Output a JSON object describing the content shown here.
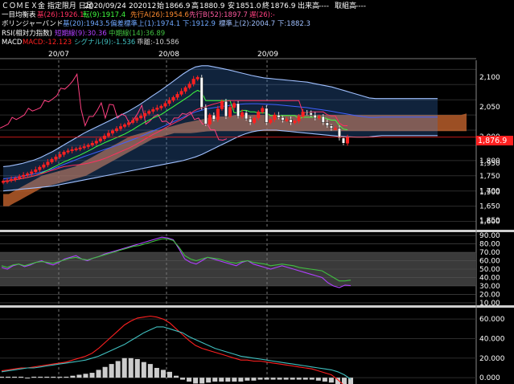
{
  "header": {
    "symbol": "ＣＯＭＥＸ金 指定限月 日足",
    "date": "2020/09/24",
    "contract": "202012",
    "open_label": "始",
    "open": "1866.9",
    "high_label": "高",
    "high": "1880.9",
    "low_label": "安",
    "low": "1851.0",
    "close_label": "終",
    "close": "1876.9",
    "volume_label": "出来高",
    "volume": "----",
    "oi_label": "取組高",
    "oi": "----"
  },
  "indicators": {
    "ichimoku": {
      "name": "一目均衡表",
      "base": "基(26):1926.1",
      "conv": "転(9):1917.4",
      "span_a": "先行A(26):1954.6",
      "span_b": "先行B(52):1897.7",
      "lag": "遅(26):-"
    },
    "bollinger": {
      "name": "ボリンジャーバンド",
      "mid": "基(20):1943.5",
      "band1": "偏差標準上(1):1974.1 下:1912.9",
      "band2": "標準上(2):2004.7 下:1882.3"
    },
    "rsi": {
      "name": "RSI(相対力指数)",
      "short": "短期線(9):30.36",
      "long": "中期線(14):36.89"
    },
    "macd": {
      "name": "MACD",
      "macd": "MACD:-12.123",
      "signal": "シグナル(9):-1.536",
      "hist": "乖離:-10.586"
    }
  },
  "colors": {
    "background": "#000000",
    "label": "#ffffff",
    "up_candle": "#ff2020",
    "down_candle": "#ffffff",
    "ichimoku_cloud": "#d06a30",
    "bollinger_fill": "#3a7fd6",
    "base_line": "#ff3060",
    "conv_line": "#40ff40",
    "span_a": "#ff8c30",
    "span_b": "#ff5aa0",
    "lag_line": "#ff4080",
    "bb_mid": "#4060ff",
    "bb_1": "#6fa8ff",
    "bb_2": "#a0c0ff",
    "rsi_short": "#b040ff",
    "rsi_long": "#40c040",
    "macd": "#ff2020",
    "signal": "#40c0c0",
    "hist": "#cccccc",
    "last_price_box": "#ff2020",
    "divider": "#cfcfcf"
  },
  "chart_data": [
    {
      "type": "candlestick",
      "panel": "price",
      "x_labels": [
        "20/07",
        "20/08",
        "20/09"
      ],
      "ylim": [
        1575,
        2130
      ],
      "y_ticks": [
        "1,600",
        "1,650",
        "1,700",
        "1,750",
        "1,800",
        "1,850",
        "1,900",
        "1,950",
        "2,000",
        "2,050",
        "2,100"
      ],
      "y_tick_values": [
        1600,
        1650,
        1700,
        1750,
        1800,
        1850,
        1900,
        1950,
        2000,
        2050,
        2100
      ],
      "last_price_label": "1,876.9",
      "last_price": 1876.9,
      "close_series": [
        1732,
        1734,
        1738,
        1742,
        1747,
        1752,
        1757,
        1763,
        1770,
        1778,
        1786,
        1795,
        1804,
        1812,
        1820,
        1828,
        1832,
        1836,
        1839,
        1842,
        1846,
        1851,
        1857,
        1864,
        1872,
        1881,
        1890,
        1898,
        1905,
        1912,
        1918,
        1925,
        1932,
        1940,
        1947,
        1955,
        1962,
        1968,
        1973,
        1979,
        1988,
        1998,
        2008,
        2018,
        2028,
        2040,
        2052,
        2068,
        2074,
        1975,
        1920,
        1950,
        1935,
        1970,
        1995,
        1945,
        1975,
        1988,
        1945,
        1958,
        1937,
        1925,
        1940,
        1960,
        1972,
        1925,
        1935,
        1950,
        1942,
        1933,
        1935,
        1925,
        1930,
        1945,
        1960,
        1957,
        1950,
        1940,
        1945,
        1925,
        1914,
        1906,
        1906,
        1874,
        1857,
        1876.9
      ],
      "bb_upper_series": [
        1780,
        1782,
        1786,
        1790,
        1796,
        1802,
        1810,
        1820,
        1830,
        1842,
        1854,
        1866,
        1878,
        1890,
        1900,
        1910,
        1920,
        1930,
        1940,
        1950,
        1960,
        1972,
        1984,
        1998,
        2012,
        2026,
        2040,
        2055,
        2070,
        2085,
        2098,
        2108,
        2112,
        2112,
        2108,
        2104,
        2100,
        2095,
        2090,
        2085,
        2080,
        2076,
        2072,
        2070,
        2068,
        2066,
        2064,
        2062,
        2060,
        2058,
        2054,
        2050,
        2046,
        2042,
        2036,
        2030,
        2024,
        2018,
        2012,
        2006,
        2004,
        2004,
        2004,
        2004,
        2004,
        2004,
        2004,
        2004,
        2004,
        2004,
        2004
      ],
      "bb_lower_series": [
        1700,
        1702,
        1704,
        1706,
        1708,
        1710,
        1712,
        1714,
        1716,
        1720,
        1724,
        1728,
        1732,
        1736,
        1740,
        1744,
        1748,
        1752,
        1756,
        1760,
        1764,
        1768,
        1772,
        1776,
        1780,
        1784,
        1788,
        1792,
        1796,
        1800,
        1806,
        1812,
        1820,
        1830,
        1840,
        1850,
        1860,
        1870,
        1880,
        1888,
        1894,
        1898,
        1900,
        1900,
        1900,
        1898,
        1896,
        1894,
        1892,
        1890,
        1888,
        1886,
        1884,
        1882,
        1880,
        1879,
        1878,
        1877,
        1877,
        1878,
        1880,
        1882,
        1882,
        1882,
        1882,
        1882,
        1882,
        1882,
        1882,
        1882,
        1882
      ],
      "cloud_top_series": [
        1690,
        1690,
        1700,
        1710,
        1720,
        1730,
        1740,
        1750,
        1755,
        1760,
        1765,
        1770,
        1775,
        1780,
        1790,
        1800,
        1810,
        1820,
        1830,
        1840,
        1850,
        1860,
        1870,
        1880,
        1885,
        1890,
        1895,
        1900,
        1900,
        1905,
        1910,
        1915,
        1920,
        1925,
        1928,
        1932,
        1935,
        1940,
        1942,
        1945,
        1945,
        1945,
        1950,
        1950,
        1950,
        1950,
        1950,
        1950,
        1950,
        1950,
        1950,
        1950,
        1950,
        1950,
        1950,
        1950,
        1950,
        1950,
        1950,
        1950,
        1950,
        1950,
        1950,
        1950,
        1950,
        1950,
        1950,
        1950,
        1950,
        1950,
        1950,
        1950,
        1950,
        1950,
        1950,
        1950,
        1950,
        1950,
        1950,
        1950,
        1950,
        1950,
        1950,
        1950,
        1955
      ],
      "cloud_bot_series": [
        1650,
        1650,
        1660,
        1670,
        1680,
        1690,
        1700,
        1710,
        1715,
        1720,
        1725,
        1730,
        1735,
        1740,
        1745,
        1750,
        1760,
        1770,
        1780,
        1790,
        1800,
        1810,
        1820,
        1830,
        1840,
        1850,
        1860,
        1870,
        1875,
        1880,
        1885,
        1890,
        1890,
        1890,
        1890,
        1892,
        1894,
        1896,
        1897,
        1897,
        1897,
        1897,
        1897,
        1897,
        1897,
        1897,
        1897,
        1897,
        1897,
        1897,
        1897,
        1897,
        1897,
        1897,
        1897,
        1897,
        1897,
        1897,
        1897,
        1897,
        1897,
        1897,
        1897,
        1897,
        1897,
        1897,
        1897,
        1897,
        1897,
        1897,
        1897,
        1897,
        1897,
        1897,
        1897,
        1897,
        1897,
        1897,
        1897,
        1897,
        1897,
        1897,
        1897,
        1897,
        1897
      ]
    },
    {
      "type": "line",
      "panel": "rsi",
      "ylim": [
        8,
        92
      ],
      "y_ticks": [
        "10.00",
        "20.00",
        "30.00",
        "40.00",
        "50.00",
        "60.00",
        "70.00",
        "80.00",
        "90.00"
      ],
      "y_tick_values": [
        10,
        20,
        30,
        40,
        50,
        60,
        70,
        80,
        90
      ],
      "series": [
        {
          "name": "短期線(9)",
          "values": [
            52,
            50,
            54,
            56,
            53,
            55,
            58,
            60,
            57,
            55,
            58,
            62,
            64,
            66,
            62,
            60,
            63,
            65,
            68,
            70,
            72,
            74,
            76,
            78,
            80,
            82,
            84,
            86,
            88,
            87,
            85,
            74,
            62,
            58,
            56,
            60,
            64,
            62,
            60,
            58,
            56,
            54,
            58,
            60,
            56,
            54,
            52,
            50,
            52,
            54,
            52,
            50,
            48,
            46,
            44,
            42,
            40,
            34,
            30,
            28,
            31,
            30.36
          ]
        },
        {
          "name": "中期線(14)",
          "values": [
            54,
            52,
            55,
            56,
            54,
            56,
            58,
            59,
            58,
            57,
            59,
            61,
            63,
            64,
            62,
            61,
            63,
            65,
            67,
            69,
            71,
            73,
            75,
            77,
            78,
            80,
            82,
            84,
            86,
            86,
            84,
            76,
            66,
            62,
            60,
            62,
            64,
            63,
            62,
            60,
            58,
            57,
            59,
            60,
            58,
            57,
            56,
            54,
            55,
            56,
            55,
            54,
            52,
            51,
            50,
            49,
            48,
            44,
            40,
            36,
            36,
            36.89
          ]
        }
      ]
    },
    {
      "type": "line",
      "panel": "macd",
      "ylim": [
        -4,
        70
      ],
      "y_ticks": [
        "0.000",
        "20.000",
        "40.000",
        "60.000"
      ],
      "y_tick_values": [
        0,
        20,
        40,
        60
      ],
      "series": [
        {
          "name": "MACD",
          "values": [
            7,
            8,
            9,
            10,
            10,
            11,
            12,
            13,
            14,
            15,
            16,
            18,
            20,
            22,
            25,
            30,
            36,
            42,
            48,
            54,
            58,
            61,
            62,
            63,
            62,
            60,
            56,
            50,
            44,
            38,
            33,
            30,
            28,
            26,
            24,
            22,
            20,
            18,
            18,
            17,
            17,
            16,
            15,
            14,
            13,
            12,
            11,
            10,
            9,
            7,
            5,
            3,
            -2,
            -8,
            -12.123
          ]
        },
        {
          "name": "シグナル(9)",
          "values": [
            6,
            7,
            8,
            9,
            10,
            10,
            11,
            12,
            13,
            14,
            15,
            16,
            17,
            18,
            20,
            22,
            25,
            28,
            31,
            34,
            38,
            42,
            46,
            49,
            52,
            52,
            50,
            48,
            46,
            42,
            39,
            36,
            33,
            30,
            28,
            26,
            24,
            22,
            21,
            20,
            19,
            18,
            17,
            16,
            15,
            14,
            13,
            12,
            11,
            10,
            9,
            8,
            6,
            3,
            -1.536
          ]
        }
      ],
      "histogram": [
        1,
        1,
        1,
        1,
        0,
        1,
        1,
        1,
        1,
        1,
        1,
        2,
        3,
        4,
        5,
        8,
        11,
        14,
        17,
        20,
        20,
        19,
        16,
        14,
        10,
        8,
        6,
        2,
        -2,
        -4,
        -6,
        -6,
        -5,
        -4,
        -4,
        -4,
        -4,
        -4,
        -3,
        -3,
        -2,
        -2,
        -2,
        -2,
        -2,
        -2,
        -2,
        -2,
        -2,
        -3,
        -4,
        -5,
        -8,
        -11,
        -10.586
      ]
    }
  ]
}
